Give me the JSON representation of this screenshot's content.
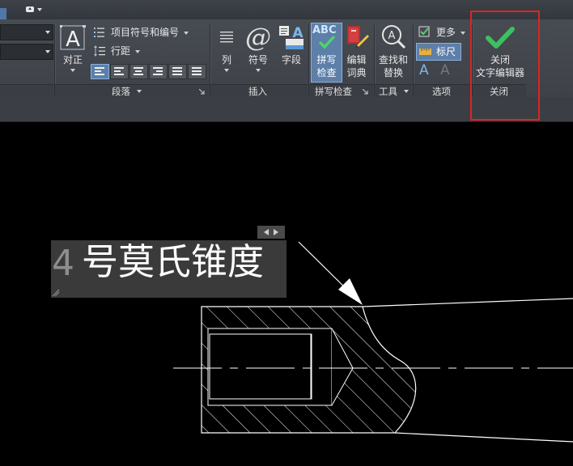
{
  "ribbon": {
    "justify": {
      "label": "对正"
    },
    "bullets": {
      "label": "项目符号和编号"
    },
    "line_spacing": {
      "label": "行距"
    },
    "paragraph_panel": {
      "label": "段落"
    },
    "columns": {
      "label": "列"
    },
    "symbol": {
      "label": "符号"
    },
    "field": {
      "label": "字段"
    },
    "insert_panel": {
      "label": "插入"
    },
    "spell_check": {
      "label_line1": "拼写",
      "label_line2": "检查",
      "icon_text": "ABC"
    },
    "edit_dictionary": {
      "label_line1": "编辑",
      "label_line2": "词典"
    },
    "spell_panel": {
      "label": "拼写检查"
    },
    "find_replace": {
      "label_line1": "查找和",
      "label_line2": "替换"
    },
    "tools_panel": {
      "label": "工具"
    },
    "more": {
      "label": "更多"
    },
    "ruler": {
      "label": "标尺"
    },
    "options_panel": {
      "label": "选项"
    },
    "close_editor": {
      "label_line1": "关闭",
      "label_line2": "文字编辑器"
    },
    "close_panel": {
      "label": "关闭"
    }
  },
  "editor": {
    "text": "号莫氏锥度",
    "cursor_char": "4"
  },
  "colors": {
    "accent": "#5d7fa8",
    "highlight_box": "#e0231f",
    "check_green": "#3cc060",
    "editor_bg": "#3a3a3a"
  }
}
